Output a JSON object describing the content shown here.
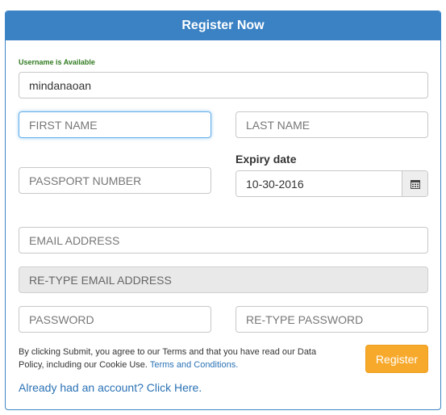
{
  "header": {
    "title": "Register Now"
  },
  "username": {
    "status": "Username is Available",
    "value": "mindanaoan",
    "status_color": "#2f7a1f"
  },
  "first_name": {
    "placeholder": "FIRST NAME"
  },
  "last_name": {
    "placeholder": "LAST NAME"
  },
  "passport": {
    "placeholder": "PASSPORT NUMBER"
  },
  "expiry": {
    "label": "Expiry date",
    "value": "10-30-2016",
    "icon": "calendar-icon"
  },
  "email": {
    "placeholder": "EMAIL ADDRESS"
  },
  "retype_email": {
    "placeholder": "RE-TYPE EMAIL ADDRESS"
  },
  "password": {
    "placeholder": "PASSWORD"
  },
  "retype_password": {
    "placeholder": "RE-TYPE PASSWORD"
  },
  "terms": {
    "text": "By clicking Submit, you agree to our Terms and that you have read our Data Policy, including our Cookie Use.",
    "link_label": "Terms and Conditions."
  },
  "register_button": {
    "label": "Register",
    "color": "#f7a92c"
  },
  "login_link": {
    "label": "Already had an account? Click Here."
  },
  "colors": {
    "header": "#3a82c4",
    "link": "#2a72b5"
  }
}
